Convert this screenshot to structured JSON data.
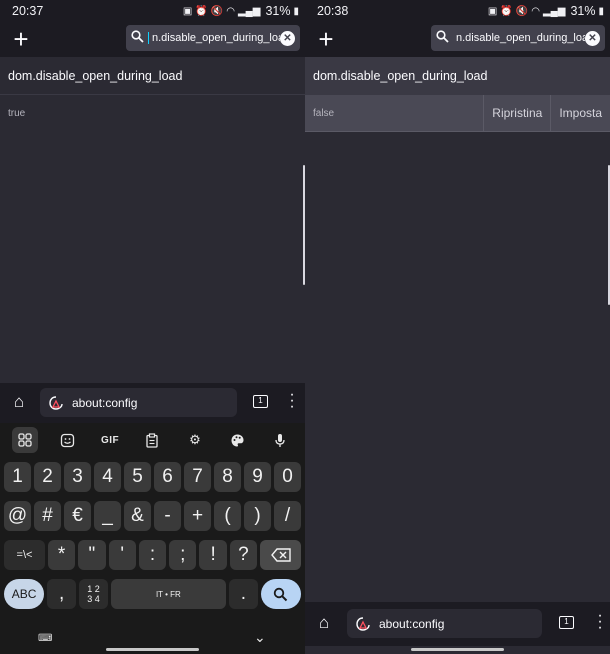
{
  "left": {
    "status": {
      "time": "20:37",
      "battery": "31%"
    },
    "search": {
      "value": "n.disable_open_during_load"
    },
    "pref": {
      "name": "dom.disable_open_during_load",
      "value": "true"
    },
    "url": "about:config",
    "tab_count": "1",
    "keyboard": {
      "row1": [
        "1",
        "2",
        "3",
        "4",
        "5",
        "6",
        "7",
        "8",
        "9",
        "0"
      ],
      "row2": [
        "@",
        "#",
        "€",
        "_",
        "&",
        "-",
        "+",
        "(",
        ")",
        "/"
      ],
      "row3": [
        "=\\<",
        "*",
        "\"",
        "'",
        ":",
        ";",
        "!",
        "?"
      ],
      "abc_label": "ABC",
      "comma": ",",
      "nums_label_top": "1 2",
      "nums_label_bottom": "3 4",
      "space_label": "IT • FR",
      "period": "."
    }
  },
  "right": {
    "status": {
      "time": "20:38",
      "battery": "31%"
    },
    "search": {
      "value": "n.disable_open_during_load"
    },
    "pref": {
      "name": "dom.disable_open_during_load",
      "value": "false"
    },
    "buttons": {
      "reset": "Ripristina",
      "set": "Imposta"
    },
    "url": "about:config",
    "tab_count": "1"
  }
}
